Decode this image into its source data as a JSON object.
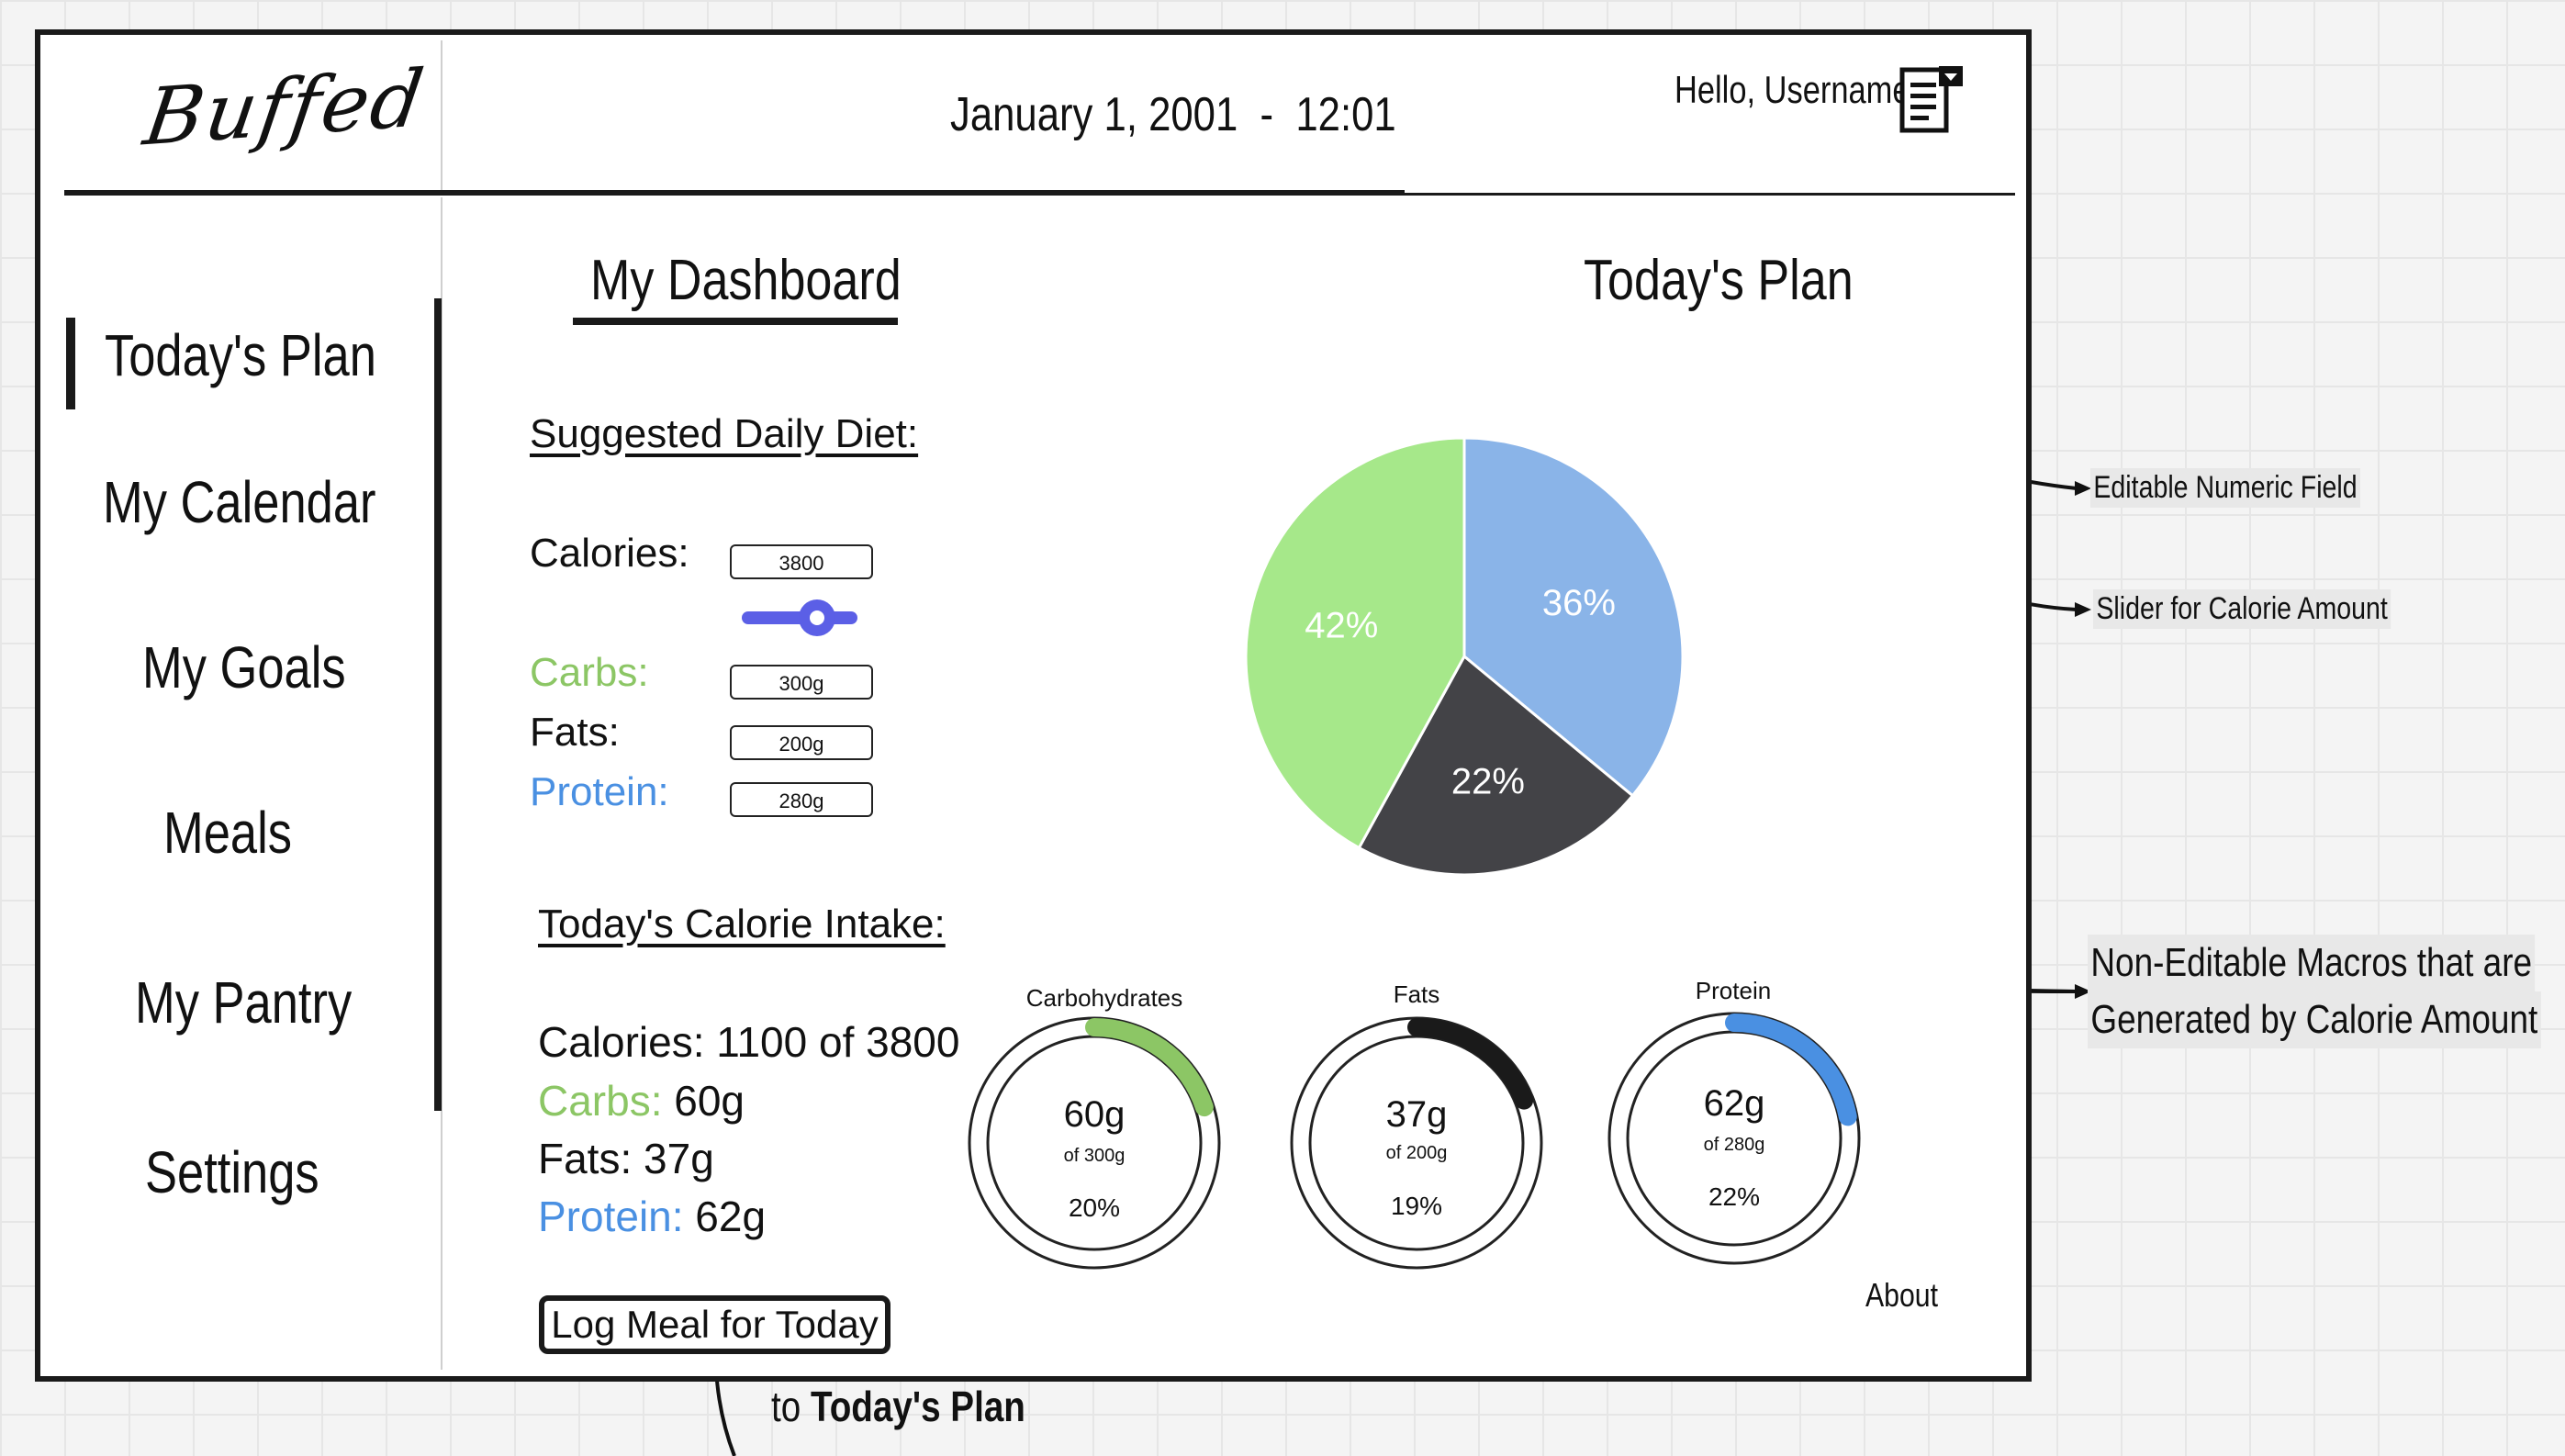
{
  "app": {
    "logo": "Buffed"
  },
  "header": {
    "datetime": "January 1, 2001  -  12:01",
    "greeting": "Hello, Username",
    "user_icon": "user-menu-icon"
  },
  "sidebar": {
    "items": [
      {
        "label": "Today's Plan",
        "active": true
      },
      {
        "label": "My Calendar"
      },
      {
        "label": "My Goals"
      },
      {
        "label": "Meals"
      },
      {
        "label": "My Pantry"
      },
      {
        "label": "Settings"
      }
    ]
  },
  "main": {
    "title": "My Dashboard",
    "plan_title": "Today's Plan",
    "suggested": {
      "heading": "Suggested Daily Diet:",
      "calories_label": "Calories:",
      "calories_value": "3800",
      "carbs_label": "Carbs:",
      "carbs_value": "300g",
      "fats_label": "Fats:",
      "fats_value": "200g",
      "protein_label": "Protein:",
      "protein_value": "280g"
    },
    "intake": {
      "heading": "Today's Calorie Intake:",
      "calories_line": "Calories: 1100 of 3800",
      "carbs_label": "Carbs:",
      "carbs_value": " 60g",
      "fats_line": "Fats: 37g",
      "protein_label": "Protein:",
      "protein_value": " 62g"
    },
    "log_button": "Log Meal for Today",
    "about": "About"
  },
  "chart_data": {
    "type": "pie",
    "slices": [
      {
        "label": "36%",
        "value": 36,
        "color": "#8ab4e8"
      },
      {
        "label": "22%",
        "value": 22,
        "color": "#434347"
      },
      {
        "label": "42%",
        "value": 42,
        "color": "#a6e88a"
      }
    ]
  },
  "gauges": [
    {
      "title": "Carbohydrates",
      "value": "60g",
      "of": "of 300g",
      "pct": "20%",
      "fraction": 0.2,
      "color": "#8cc665"
    },
    {
      "title": "Fats",
      "value": "37g",
      "of": "of 200g",
      "pct": "19%",
      "fraction": 0.19,
      "color": "#1a1a1a"
    },
    {
      "title": "Protein",
      "value": "62g",
      "of": "of 280g",
      "pct": "22%",
      "fraction": 0.22,
      "color": "#4a90e2"
    }
  ],
  "annotations": {
    "editable_field": "Editable Numeric Field",
    "slider": "Slider for Calorie Amount",
    "macros_line1": "Non-Editable Macros that are",
    "macros_line2": "Generated by Calorie Amount",
    "flow_prefix": "to ",
    "flow_target": "Today's Plan"
  }
}
